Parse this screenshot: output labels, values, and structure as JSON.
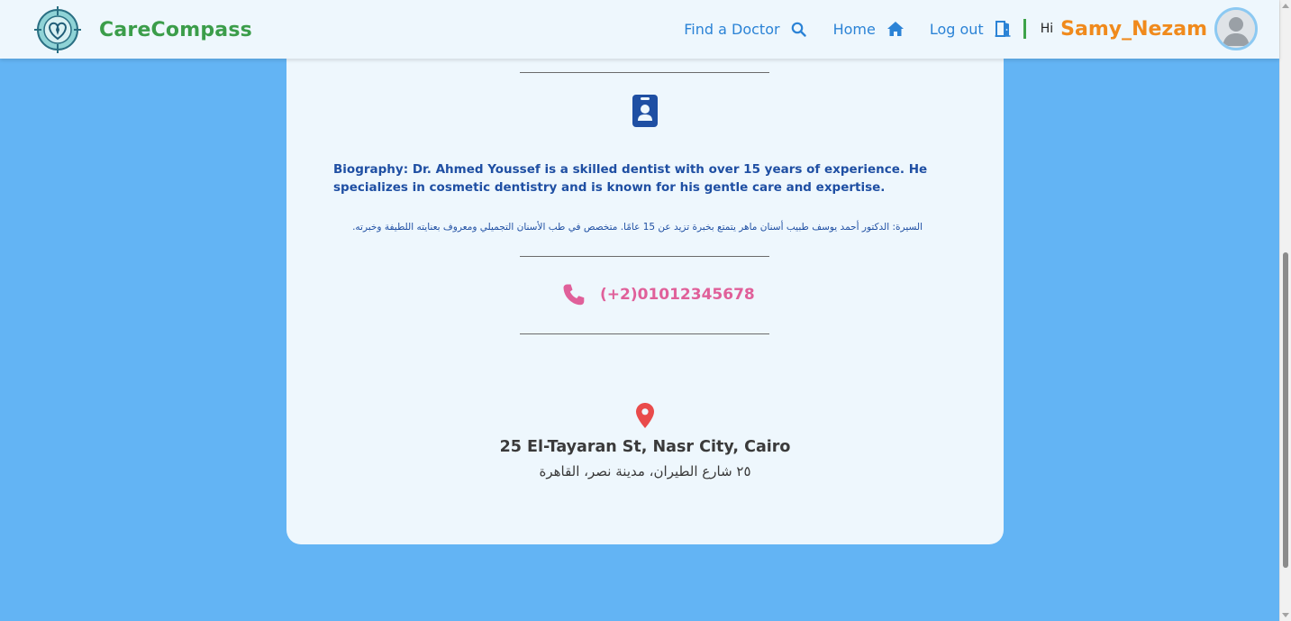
{
  "navbar": {
    "brand": "CareCompass",
    "links": {
      "find_doctor": "Find a Doctor",
      "home": "Home",
      "logout": "Log out"
    },
    "greeting": "Hi",
    "username": "Samy_Nezam",
    "icons": {
      "logo": "carecompass-logo-icon",
      "find": "search-icon",
      "home": "home-icon",
      "logout": "door-exit-icon",
      "avatar": "user-avatar-icon"
    }
  },
  "profile": {
    "bio_label": "Biography:",
    "bio_text": "Dr. Ahmed Youssef is a skilled dentist with over 15 years of experience. He specializes in cosmetic dentistry and is known for his gentle care and expertise.",
    "bio_arabic": "السيرة: الدكتور أحمد يوسف طبيب أسنان ماهر يتمتع بخبرة تزيد عن 15 عامًا. متخصص في طب الأسنان التجميلي ومعروف بعنايته اللطيفة وخبرته.",
    "phone": "(+2)01012345678",
    "address_en": "25 El-Tayaran St, Nasr City, Cairo",
    "address_ar": "٢٥ شارع الطيران، مدينة نصر، القاهرة",
    "icons": {
      "id_badge": "id-badge-icon",
      "phone": "phone-icon",
      "location": "location-pin-icon"
    }
  },
  "colors": {
    "page_bg": "#63b4f4",
    "card_bg": "#eef7fd",
    "brand_green": "#3b9d4a",
    "link_blue": "#2b83d6",
    "username_orange": "#f08a1c",
    "bio_blue": "#1f4fa3",
    "phone_pink": "#e0609a",
    "pin_red": "#e94b4b"
  }
}
